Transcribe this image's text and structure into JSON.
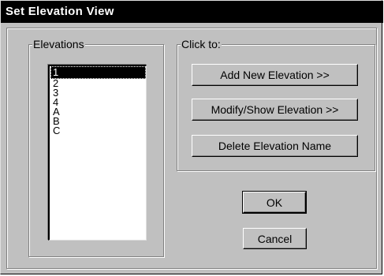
{
  "window": {
    "title": "Set Elevation View"
  },
  "elevations": {
    "label": "Elevations",
    "items": [
      "1",
      "2",
      "3",
      "4",
      "A",
      "B",
      "C"
    ],
    "selected_index": 0
  },
  "actions": {
    "label": "Click to:",
    "add_label": "Add New Elevation  >>",
    "modify_label": "Modify/Show Elevation  >>",
    "delete_label": "Delete Elevation Name"
  },
  "footer": {
    "ok_label": "OK",
    "cancel_label": "Cancel"
  }
}
